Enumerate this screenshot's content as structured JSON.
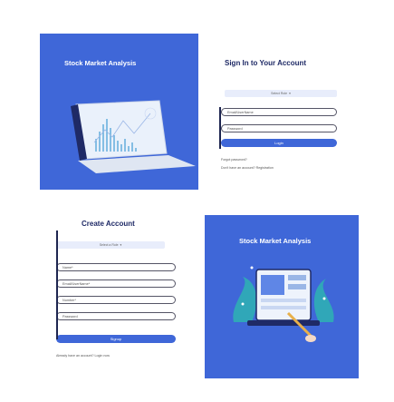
{
  "top_left": {
    "brand_title": "Stock Market Analysis"
  },
  "login": {
    "title": "Sign In to Your Account",
    "role_select": "Select Role",
    "email_placeholder": "Email/UserName",
    "password_placeholder": "Password",
    "login_button": "Login",
    "forgot_link": "Forgot password?",
    "register_text": "Don't have an account? Registration"
  },
  "signup": {
    "title": "Create Account",
    "role_select": "Select a Role",
    "name_placeholder": "Name*",
    "email_placeholder": "Email/UserName*",
    "number_placeholder": "Number*",
    "password_placeholder": "Password",
    "signup_button": "Signup",
    "login_text": "Already have an account? Login now"
  },
  "bottom_right": {
    "brand_title": "Stock Market Analysis"
  },
  "colors": {
    "primary": "#3f67d8",
    "navy": "#1f2a66",
    "field_bg": "#e8edfb"
  },
  "icons": [
    "laptop-chart-icon",
    "analytics-dashboard-icon",
    "chevron-down-icon"
  ]
}
